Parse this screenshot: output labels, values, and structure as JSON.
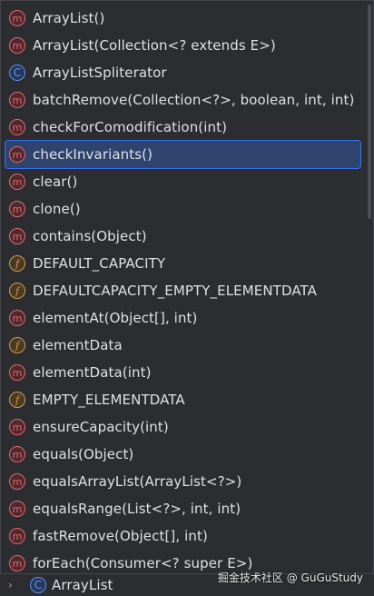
{
  "completion": {
    "items": [
      {
        "kind": "m",
        "icon": "method-icon",
        "label": "ArrayList()"
      },
      {
        "kind": "m",
        "icon": "method-icon",
        "label": "ArrayList(Collection<? extends E>)"
      },
      {
        "kind": "c",
        "icon": "class-icon",
        "label": "ArrayListSpliterator"
      },
      {
        "kind": "m",
        "icon": "method-icon",
        "label": "batchRemove(Collection<?>, boolean, int, int)"
      },
      {
        "kind": "m",
        "icon": "method-icon",
        "label": "checkForComodification(int)"
      },
      {
        "kind": "m",
        "icon": "method-icon",
        "label": "checkInvariants()"
      },
      {
        "kind": "m",
        "icon": "method-icon",
        "label": "clear()"
      },
      {
        "kind": "m",
        "icon": "method-icon",
        "label": "clone()"
      },
      {
        "kind": "m",
        "icon": "method-icon",
        "label": "contains(Object)"
      },
      {
        "kind": "f",
        "icon": "field-icon",
        "label": "DEFAULT_CAPACITY"
      },
      {
        "kind": "f",
        "icon": "field-icon",
        "label": "DEFAULTCAPACITY_EMPTY_ELEMENTDATA"
      },
      {
        "kind": "m",
        "icon": "method-icon",
        "label": "elementAt(Object[], int)"
      },
      {
        "kind": "f",
        "icon": "field-icon",
        "label": "elementData"
      },
      {
        "kind": "m",
        "icon": "method-icon",
        "label": "elementData(int)"
      },
      {
        "kind": "f",
        "icon": "field-icon",
        "label": "EMPTY_ELEMENTDATA"
      },
      {
        "kind": "m",
        "icon": "method-icon",
        "label": "ensureCapacity(int)"
      },
      {
        "kind": "m",
        "icon": "method-icon",
        "label": "equals(Object)"
      },
      {
        "kind": "m",
        "icon": "method-icon",
        "label": "equalsArrayList(ArrayList<?>)"
      },
      {
        "kind": "m",
        "icon": "method-icon",
        "label": "equalsRange(List<?>, int, int)"
      },
      {
        "kind": "m",
        "icon": "method-icon",
        "label": "fastRemove(Object[], int)"
      },
      {
        "kind": "m",
        "icon": "method-icon",
        "label": "forEach(Consumer<? super E>)"
      }
    ],
    "selected_label": "checkInvariants()"
  },
  "badge_glyphs": {
    "m": "m",
    "c": "C",
    "f": "f"
  },
  "breadcrumb": {
    "chevron": "›",
    "icon": "class-icon",
    "label": "ArrayList"
  },
  "watermark": "掘金技术社区 @ GuGuStudy",
  "colors": {
    "background": "#2b2d30",
    "selection": "#2e436e",
    "method": "#e5676f",
    "class": "#5f92f3",
    "field": "#d49a4c",
    "text": "#dfe1e5"
  }
}
